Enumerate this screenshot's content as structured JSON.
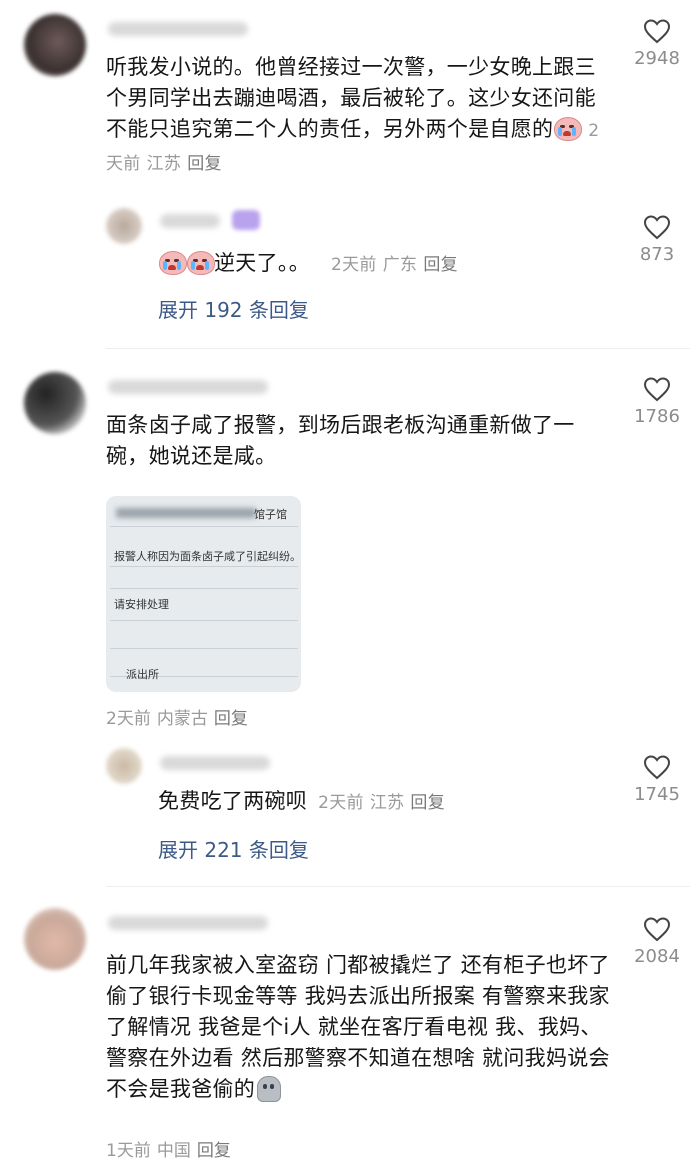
{
  "comments": [
    {
      "text": "听我发小说的。他曾经接过一次警，一少女晚上跟三个男同学出去蹦迪喝酒，最后被轮了。这少女还问能不能只追究第二个人的责任，另外两个是自愿的",
      "emoji": "crying-face",
      "time": "2天前",
      "location": "江苏",
      "reply_label": "回复",
      "likes": "2948",
      "sub_reply": {
        "emoji_count": 2,
        "text": "逆天了。。",
        "time": "2天前",
        "location": "广东",
        "reply_label": "回复",
        "likes": "873"
      },
      "expand_label": "展开 192 条回复"
    },
    {
      "text": "面条卤子咸了报警，到场后跟老板沟通重新做了一碗，她说还是咸。",
      "image": {
        "line1": "报警人称因为面条卤子咸了引起纠纷。",
        "line2": "请安排处理",
        "line3": "派出所",
        "header": "馆子馆"
      },
      "time": "2天前",
      "location": "内蒙古",
      "reply_label": "回复",
      "likes": "1786",
      "sub_reply": {
        "text": "免费吃了两碗呗",
        "time": "2天前",
        "location": "江苏",
        "reply_label": "回复",
        "likes": "1745"
      },
      "expand_label": "展开 221 条回复"
    },
    {
      "text": "前几年我家被入室盗窃 门都被撬烂了 还有柜子也坏了 偷了银行卡现金等等 我妈去派出所报案 有警察来我家了解情况 我爸是个i人 就坐在客厅看电视 我、我妈、警察在外边看 然后那警察不知道在想啥 就问我妈说会不会是我爸偷的",
      "emoji": "ghost-face",
      "time": "1天前",
      "location": "中国",
      "reply_label": "回复",
      "likes": "2084"
    }
  ],
  "colors": {
    "text": "#161616",
    "meta": "#9a9a9a",
    "expand": "#3d5a87",
    "like_count": "#8c8c8c"
  },
  "icons": {
    "like": "heart-outline-icon"
  }
}
